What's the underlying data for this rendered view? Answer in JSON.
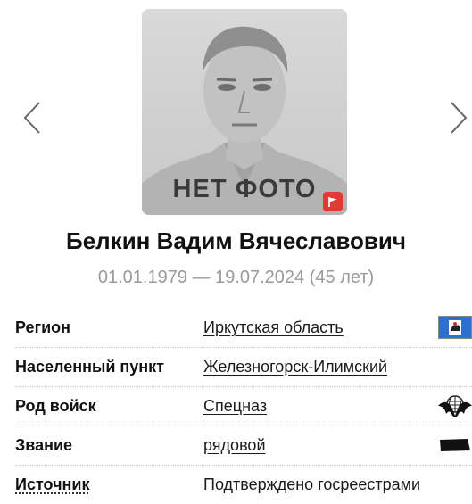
{
  "colors": {
    "accent": "#e13a32",
    "muted_text": "#9a9a9a",
    "divider": "#c8c8c8"
  },
  "photo": {
    "label": "НЕТ ФОТО",
    "badge_icon": "flag-icon"
  },
  "person": {
    "name": "Белкин Вадим Вячеславович",
    "dates": "01.01.1979 — 19.07.2024 (45 лет)"
  },
  "details": {
    "region": {
      "label": "Регион",
      "value": "Иркутская область",
      "icon": "region-flag-icon"
    },
    "settlement": {
      "label": "Населенный пункт",
      "value": "Железногорск-Илимский"
    },
    "branch": {
      "label": "Род войск",
      "value": "Спецназ",
      "icon": "special-forces-emblem-icon"
    },
    "rank": {
      "label": "Звание",
      "value": "рядовой",
      "icon": "rank-insignia-icon"
    },
    "source": {
      "label": "Источник",
      "value": "Подтверждено госреестрами"
    }
  }
}
